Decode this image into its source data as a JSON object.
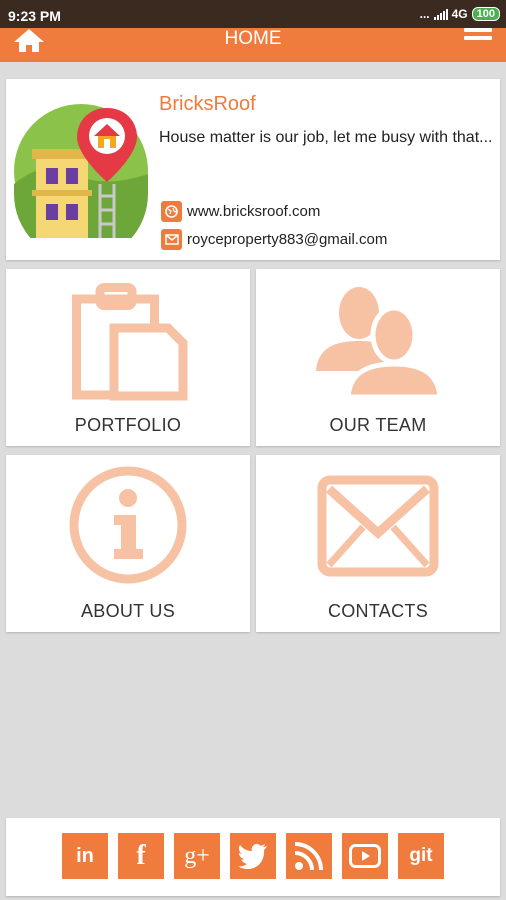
{
  "status_bar": {
    "time": "9:23 PM",
    "indicators": "...",
    "network": "4G",
    "battery": "100"
  },
  "app_bar": {
    "title": "HOME",
    "left_icon": "home-icon",
    "right_icon": "menu-icon"
  },
  "profile": {
    "name": "BricksRoof",
    "tagline": "House matter is our job, let me busy with that...",
    "website": "www.bricksroof.com",
    "email": "royceproperty883@gmail.com"
  },
  "tiles": [
    {
      "label": "PORTFOLIO",
      "icon": "clipboard-icon"
    },
    {
      "label": "OUR TEAM",
      "icon": "team-icon"
    },
    {
      "label": "ABOUT US",
      "icon": "info-icon"
    },
    {
      "label": "CONTACTS",
      "icon": "envelope-icon"
    }
  ],
  "social": [
    {
      "label": "in",
      "icon": "linkedin-icon"
    },
    {
      "label": "f",
      "icon": "facebook-icon"
    },
    {
      "label": "g+",
      "icon": "google-plus-icon"
    },
    {
      "label": "",
      "icon": "twitter-icon"
    },
    {
      "label": "",
      "icon": "rss-icon"
    },
    {
      "label": "",
      "icon": "youtube-icon"
    },
    {
      "label": "git",
      "icon": "github-icon"
    }
  ],
  "colors": {
    "accent": "#ef7b3d",
    "icon_tint": "#f7c1a4",
    "background": "#dcdcdc"
  }
}
